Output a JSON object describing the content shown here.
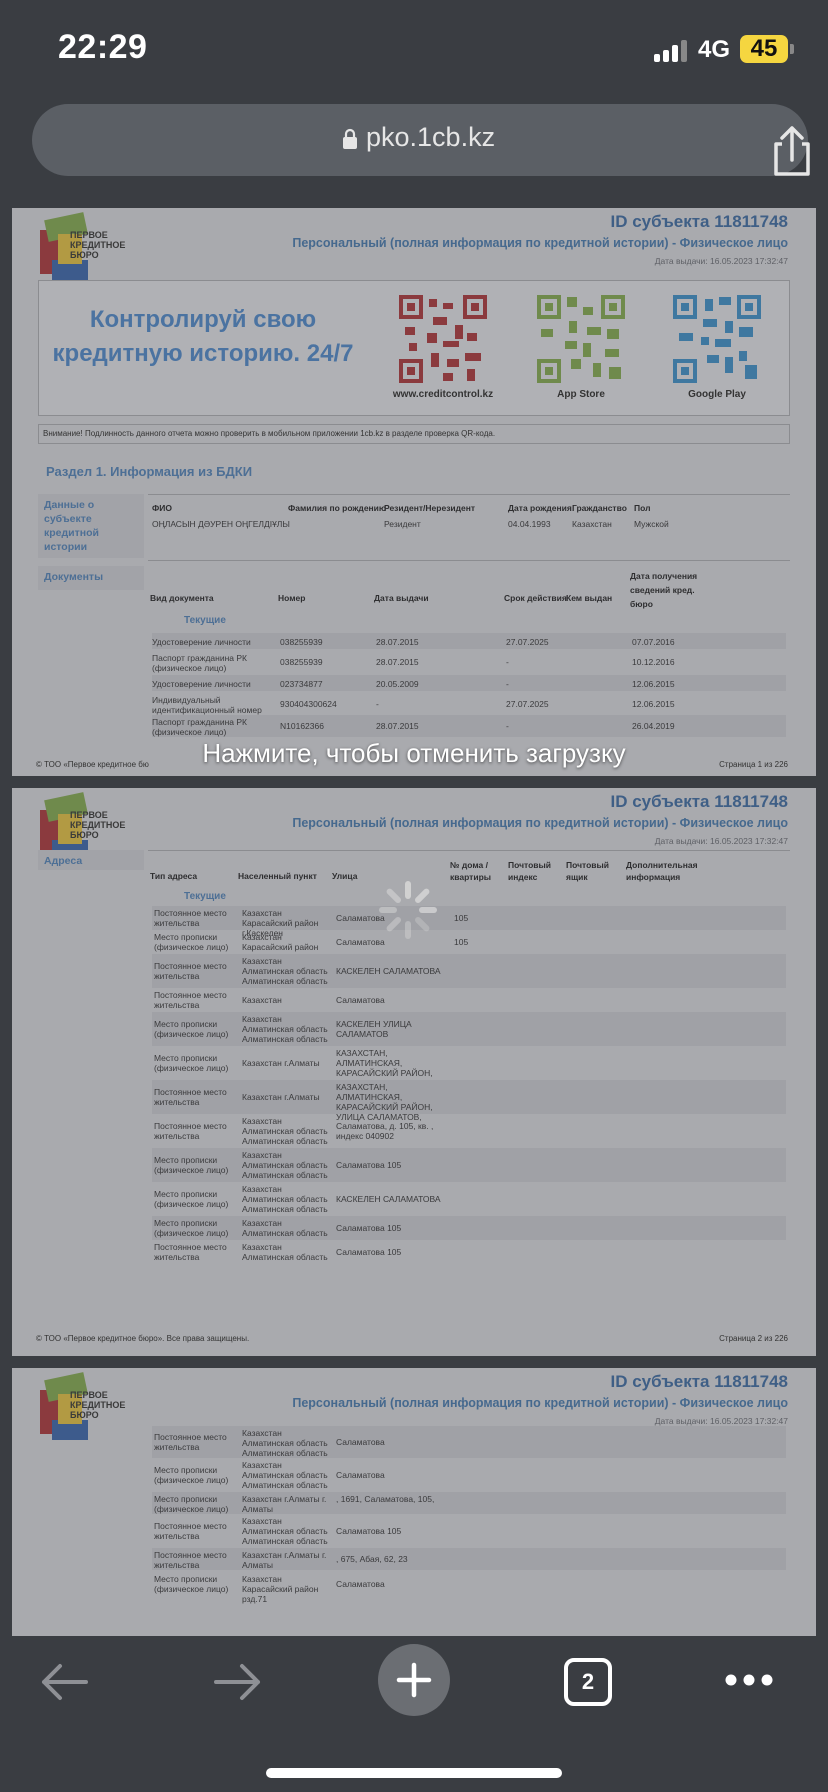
{
  "status": {
    "time": "22:29",
    "network": "4G",
    "battery": "45"
  },
  "browser": {
    "url": "pko.1cb.kz",
    "tab_count": "2"
  },
  "report": {
    "logo_text": [
      "ПЕРВОЕ",
      "КРЕДИТНОЕ",
      "БЮРО"
    ],
    "id_heading": "ID субъекта 11811748",
    "subtitle": "Персональный (полная информация по кредитной истории)  -  Физическое лицо",
    "date_issued": "Дата выдачи: 16.05.2023 17:32:47",
    "banner_text": "Контролируй свою кредитную историю. 24/7",
    "qr_captions": [
      "www.creditcontrol.kz",
      "App Store",
      "Google Play"
    ],
    "notice": "Внимание! Подлинность данного отчета можно проверить в мобильном приложении 1cb.kz в разделе проверка QR-кода.",
    "section1_title": "Раздел 1. Информация из БДКИ",
    "subject_label": "Данные о субъекте кредитной истории",
    "documents_label": "Документы",
    "subject_headers": [
      "ФИО",
      "Фамилия по рождению",
      "Резидент/Нерезидент",
      "Дата рождения",
      "Гражданство",
      "Пол"
    ],
    "subject_values": [
      "ОҢЛАСЫН ДӘУРЕН ОҢГЕЛДІҰЛЫ",
      "",
      "Резидент",
      "04.04.1993",
      "Казахстан",
      "Мужской"
    ],
    "doc_headers": [
      "Вид документа",
      "Номер",
      "Дата выдачи",
      "Срок действия",
      "Кем выдан",
      "Дата получения сведений кред. бюро"
    ],
    "current_label": "Текущие",
    "doc_rows": [
      [
        "Удостоверение личности",
        "038255939",
        "28.07.2015",
        "27.07.2025",
        "",
        "07.07.2016"
      ],
      [
        "Паспорт гражданина РК (физическое лицо)",
        "038255939",
        "28.07.2015",
        "-",
        "",
        "10.12.2016"
      ],
      [
        "Удостоверение личности",
        "023734877",
        "20.05.2009",
        "-",
        "",
        "12.06.2015"
      ],
      [
        "Индивидуальный идентификационный номер (ИИН)",
        "930404300624",
        "-",
        "27.07.2025",
        "",
        "12.06.2015"
      ],
      [
        "Паспорт гражданина РК (физическое лицо)",
        "N10162366",
        "28.07.2015",
        "-",
        "",
        "26.04.2019"
      ]
    ],
    "footer_left": "© ТОО «Первое кредитное бюро». Все права защищены.",
    "footer_left_cut": "© ТОО «Первое кредитное бю",
    "page1_label": "Страница 1 из 226",
    "page2_label": "Страница 2 из 226",
    "addresses_label": "Адреса",
    "addr_headers": [
      "Тип адреса",
      "Населенный пункт",
      "Улица",
      "№ дома /квартиры",
      "Почтовый индекс",
      "Почтовый ящик",
      "Дополнительная информация"
    ],
    "addr_rows": [
      [
        "Постоянное место жительства",
        "Казахстан Карасайский район г.Каскелен",
        "Саламатова",
        "105"
      ],
      [
        "Место прописки (физическое лицо)",
        "Казахстан Карасайский район г.Каскелен",
        "Саламатова",
        "105"
      ],
      [
        "Постоянное место жительства",
        "Казахстан Алматинская область Алматинская область",
        "КАСКЕЛЕН САЛАМАТОВА",
        ""
      ],
      [
        "Постоянное место жительства",
        "Казахстан",
        "Саламатова",
        ""
      ],
      [
        "Место прописки (физическое лицо)",
        "Казахстан Алматинская область Алматинская область",
        "КАСКЕЛЕН УЛИЦА САЛАМАТОВ",
        ""
      ],
      [
        "Место прописки (физическое лицо)",
        "Казахстан г.Алматы",
        "КАЗАХСТАН, АЛМАТИНСКАЯ, КАРАСАЙСКИЙ РАЙОН, УЛИЦА САЛАМАТОВ,",
        ""
      ],
      [
        "Постоянное место жительства",
        "Казахстан г.Алматы",
        "КАЗАХСТАН, АЛМАТИНСКАЯ, КАРАСАЙСКИЙ РАЙОН, УЛИЦА САЛАМАТОВ,",
        ""
      ],
      [
        "Постоянное место жительства",
        "Казахстан Алматинская область Алматинская область",
        "Саламатова, д. 105, кв. , индекс 040902",
        ""
      ],
      [
        "Место прописки (физическое лицо)",
        "Казахстан Алматинская область Алматинская область",
        "Саламатова 105",
        ""
      ],
      [
        "Место прописки (физическое лицо)",
        "Казахстан Алматинская область Алматинская область",
        "КАСКЕЛЕН САЛАМАТОВА",
        ""
      ],
      [
        "Место прописки (физическое лицо)",
        "Казахстан Алматинская область",
        "Саламатова 105",
        ""
      ],
      [
        "Постоянное место жительства",
        "Казахстан Алматинская область",
        "Саламатова 105",
        ""
      ]
    ],
    "addr_rows_p3": [
      [
        "Постоянное место жительства",
        "Казахстан Алматинская область Алматинская область",
        "Саламатова"
      ],
      [
        "Место прописки (физическое лицо)",
        "Казахстан Алматинская область Алматинская область",
        "Саламатова"
      ],
      [
        "Место прописки (физическое лицо)",
        "Казахстан г.Алматы г. Алматы",
        ", 1691, Саламатова, 105,"
      ],
      [
        "Постоянное место жительства",
        "Казахстан Алматинская область Алматинская область",
        "Саламатова 105"
      ],
      [
        "Постоянное место жительства",
        "Казахстан г.Алматы г. Алматы",
        ", 675, Абая, 62, 23"
      ],
      [
        "Место прописки (физическое лицо)",
        "Казахстан Карасайский район рзд.71",
        "Саламатова"
      ]
    ]
  },
  "overlay": {
    "cancel_text": "Нажмите, чтобы отменить загрузку"
  }
}
